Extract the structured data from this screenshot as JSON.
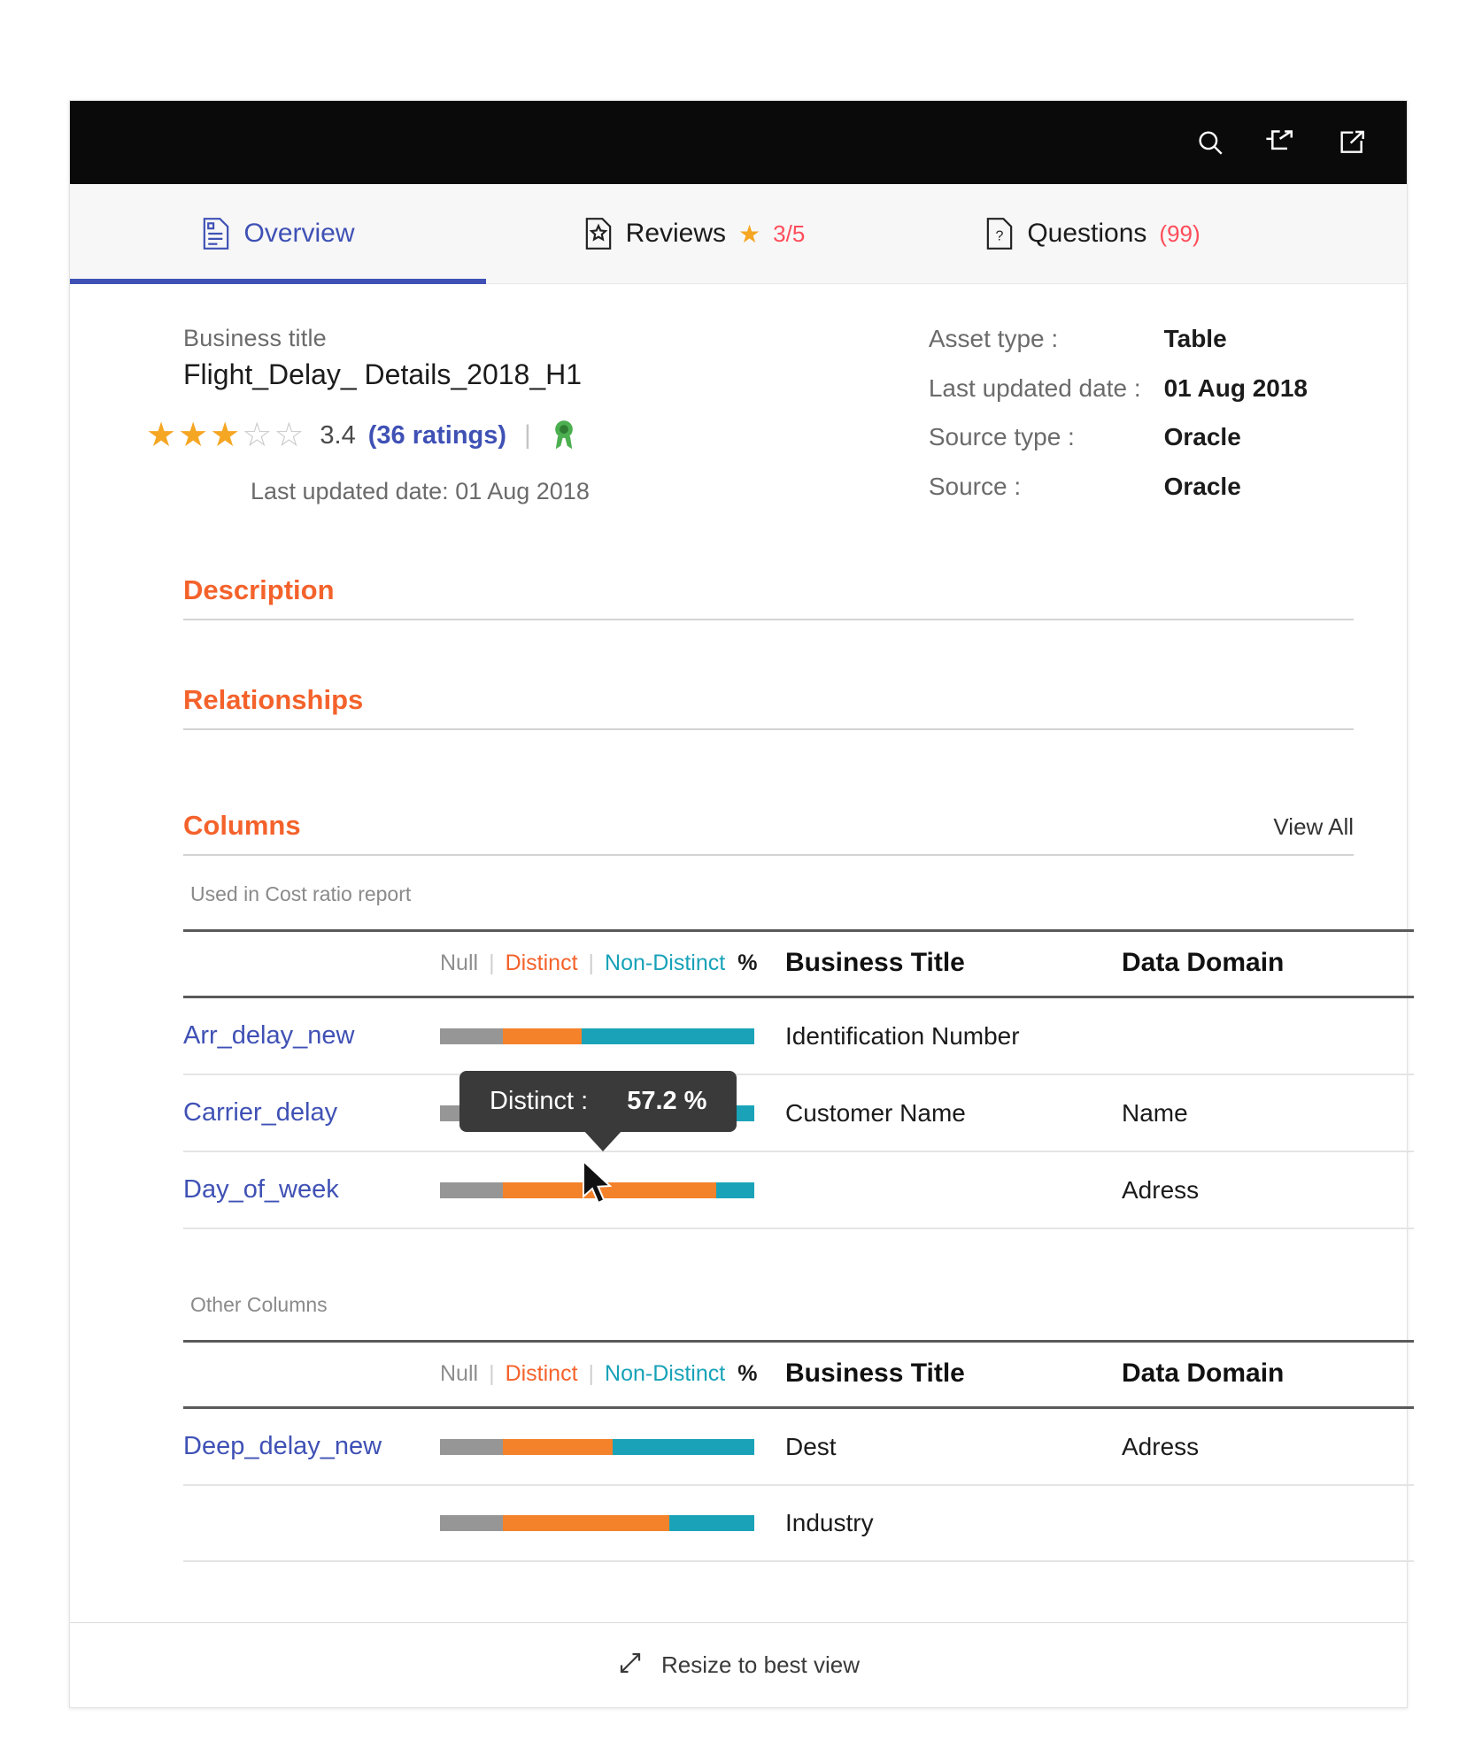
{
  "topbar": {
    "icons": [
      {
        "name": "search-icon",
        "label": "Search"
      },
      {
        "name": "lineage-icon",
        "label": "Lineage"
      },
      {
        "name": "open-in-new-icon",
        "label": "Open in new window"
      }
    ]
  },
  "tabs": [
    {
      "label": "Overview",
      "icon": "document-lines-icon",
      "active": true,
      "meta": ""
    },
    {
      "label": "Reviews",
      "icon": "document-star-icon",
      "active": false,
      "star": "★",
      "meta": "3/5"
    },
    {
      "label": "Questions",
      "icon": "document-question-icon",
      "active": false,
      "meta": "(99)"
    }
  ],
  "asset": {
    "business_title_label": "Business title",
    "business_title": "Flight_Delay_ Details_2018_H1",
    "rating_value": "3.4",
    "rating_count": "(36 ratings)",
    "stars_filled": 3,
    "stars_total": 5,
    "certified_badge": "award-badge-icon",
    "last_updated": "Last updated date: 01 Aug 2018"
  },
  "metadata": [
    {
      "key": "Asset type :",
      "value": "Table"
    },
    {
      "key": "Last updated date :",
      "value": "01 Aug 2018"
    },
    {
      "key": "Source type :",
      "value": "Oracle"
    },
    {
      "key": "Source :",
      "value": "Oracle"
    }
  ],
  "sections": {
    "description": "Description",
    "relationships": "Relationships",
    "columns": "Columns",
    "view_all": "View All"
  },
  "legend": {
    "null": "Null",
    "distinct": "Distinct",
    "non_distinct": "Non-Distinct",
    "percent": "%"
  },
  "table_headers": {
    "business_title": "Business Title",
    "data_domain": "Data Domain"
  },
  "groups": [
    {
      "label": "Used in Cost ratio report",
      "rows": [
        {
          "name": "Arr_delay_new",
          "business_title": "Identification Number",
          "data_domain": "",
          "null_pct": 20,
          "distinct_pct": 25,
          "non_distinct_pct": 55
        },
        {
          "name": "Carrier_delay",
          "business_title": "Customer Name",
          "data_domain": "Name",
          "null_pct": 20,
          "distinct_pct": 45,
          "non_distinct_pct": 35
        },
        {
          "name": "Day_of_week",
          "business_title": "",
          "data_domain": "Adress",
          "null_pct": 20,
          "distinct_pct": 68,
          "non_distinct_pct": 12
        }
      ]
    },
    {
      "label": "Other Columns",
      "rows": [
        {
          "name": "Deep_delay_new",
          "business_title": "Dest",
          "data_domain": "Adress",
          "null_pct": 20,
          "distinct_pct": 35,
          "non_distinct_pct": 45
        },
        {
          "name": "",
          "business_title": "Industry",
          "data_domain": "",
          "null_pct": 20,
          "distinct_pct": 53,
          "non_distinct_pct": 27
        }
      ]
    }
  ],
  "tooltip": {
    "label": "Distinct :",
    "value": "57.2 %"
  },
  "footer": {
    "label": "Resize to best view",
    "icon": "resize-diagonal-icon"
  },
  "colors": {
    "null": "#969696",
    "distinct": "#f4822b",
    "non_distinct": "#1aa3b8",
    "accent_orange": "#f4622b",
    "accent_blue": "#3f51b5",
    "badge_red": "#ff4d5a",
    "star": "#f5a623"
  }
}
